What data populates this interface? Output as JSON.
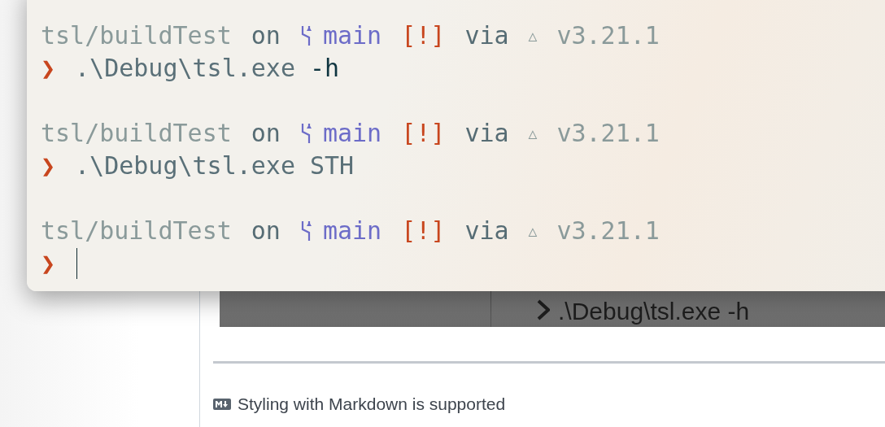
{
  "terminal": {
    "prompts": [
      {
        "directory": "tsl/buildTest",
        "on": "on",
        "branch": "main",
        "status": "[!]",
        "via": "via",
        "tool_symbol": "△",
        "version": "v3.21.1",
        "symbol": "❯",
        "command": ".\\Debug\\tsl.exe",
        "argument": {
          "text": "-h",
          "kind": "flag"
        },
        "cursor": false
      },
      {
        "directory": "tsl/buildTest",
        "on": "on",
        "branch": "main",
        "status": "[!]",
        "via": "via",
        "tool_symbol": "△",
        "version": "v3.21.1",
        "symbol": "❯",
        "command": ".\\Debug\\tsl.exe",
        "argument": {
          "text": "STH",
          "kind": "plain"
        },
        "cursor": false
      },
      {
        "directory": "tsl/buildTest",
        "on": "on",
        "branch": "main",
        "status": "[!]",
        "via": "via",
        "tool_symbol": "△",
        "version": "v3.21.1",
        "symbol": "❯",
        "cursor": true
      }
    ]
  },
  "background_screenshot": {
    "command": ".\\Debug\\tsl.exe -h"
  },
  "footer": {
    "text": "Styling with Markdown is supported"
  }
}
